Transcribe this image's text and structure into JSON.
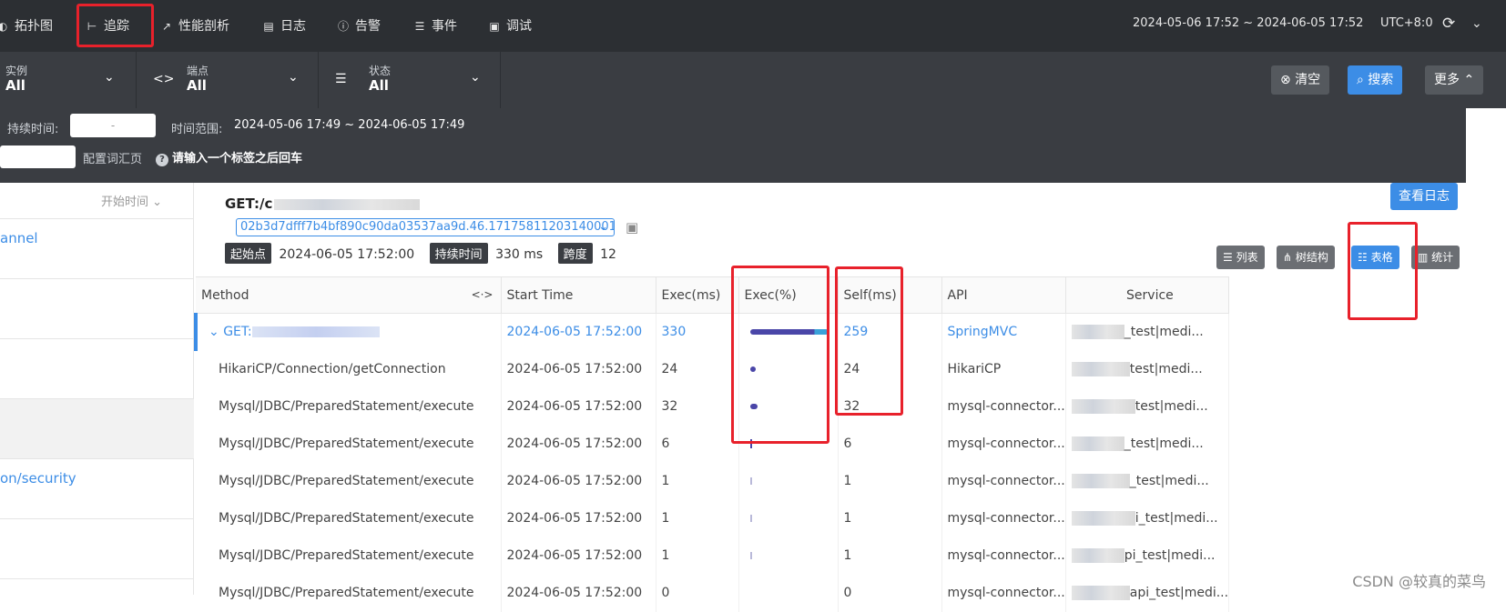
{
  "nav": {
    "items": [
      {
        "label": "拓扑图",
        "icon": "topology-icon"
      },
      {
        "label": "追踪",
        "icon": "trace-icon"
      },
      {
        "label": "性能剖析",
        "icon": "profiling-icon"
      },
      {
        "label": "日志",
        "icon": "log-icon"
      },
      {
        "label": "告警",
        "icon": "alarm-icon"
      },
      {
        "label": "事件",
        "icon": "event-icon"
      },
      {
        "label": "调试",
        "icon": "debug-icon"
      }
    ],
    "time_range": "2024-05-06 17:52 ~ 2024-06-05 17:52",
    "timezone": "UTC+8:0"
  },
  "filters": {
    "instance": {
      "label": "实例",
      "value": "All"
    },
    "endpoint": {
      "label": "端点",
      "value": "All"
    },
    "status": {
      "label": "状态",
      "value": "All"
    },
    "clear_label": "清空",
    "search_label": "搜索",
    "more_label": "更多"
  },
  "advanced": {
    "duration_label": "持续时间:",
    "duration_placeholder": "-",
    "time_range_label": "时间范围:",
    "time_range_value": "2024-05-06 17:49 ~ 2024-06-05 17:49",
    "config_label": "配置词汇页",
    "tag_hint": "请输入一个标签之后回车"
  },
  "trace_list": {
    "sort_label": "开始时间",
    "items": [
      "annel",
      "",
      "",
      "",
      "on/security",
      ""
    ]
  },
  "detail": {
    "title": "GET:/c",
    "trace_id": "02b3d7dfff7b4bf890c90da03537aa9d.46.17175811203140001",
    "start_label": "起始点",
    "start_value": "2024-06-05 17:52:00",
    "duration_label": "持续时间",
    "duration_value": "330 ms",
    "span_label": "跨度",
    "span_value": "12",
    "view_logs_label": "查看日志",
    "views": [
      "列表",
      "树结构",
      "表格",
      "统计"
    ]
  },
  "table": {
    "headers": [
      "Method",
      "Start Time",
      "Exec(ms)",
      "Exec(%)",
      "Self(ms)",
      "API",
      "Service"
    ],
    "rows": [
      {
        "method": "GET:",
        "start": "2024-06-05 17:52:00",
        "exec": "330",
        "exec_pct": 100,
        "self": "259",
        "api": "SpringMVC",
        "service": "_test|medi..."
      },
      {
        "method": "HikariCP/Connection/getConnection",
        "start": "2024-06-05 17:52:00",
        "exec": "24",
        "exec_pct": 7,
        "self": "24",
        "api": "HikariCP",
        "service": "test|medi..."
      },
      {
        "method": "Mysql/JDBC/PreparedStatement/execute",
        "start": "2024-06-05 17:52:00",
        "exec": "32",
        "exec_pct": 10,
        "self": "32",
        "api": "mysql-connector...",
        "service": "test|medi..."
      },
      {
        "method": "Mysql/JDBC/PreparedStatement/execute",
        "start": "2024-06-05 17:52:00",
        "exec": "6",
        "exec_pct": 2,
        "self": "6",
        "api": "mysql-connector...",
        "service": "_test|medi..."
      },
      {
        "method": "Mysql/JDBC/PreparedStatement/execute",
        "start": "2024-06-05 17:52:00",
        "exec": "1",
        "exec_pct": 0.3,
        "self": "1",
        "api": "mysql-connector...",
        "service": "_test|medi..."
      },
      {
        "method": "Mysql/JDBC/PreparedStatement/execute",
        "start": "2024-06-05 17:52:00",
        "exec": "1",
        "exec_pct": 0.3,
        "self": "1",
        "api": "mysql-connector...",
        "service": "i_test|medi..."
      },
      {
        "method": "Mysql/JDBC/PreparedStatement/execute",
        "start": "2024-06-05 17:52:00",
        "exec": "1",
        "exec_pct": 0.3,
        "self": "1",
        "api": "mysql-connector...",
        "service": "pi_test|medi..."
      },
      {
        "method": "Mysql/JDBC/PreparedStatement/execute",
        "start": "2024-06-05 17:52:00",
        "exec": "0",
        "exec_pct": 0,
        "self": "0",
        "api": "mysql-connector...",
        "service": "api_test|medi..."
      }
    ]
  },
  "watermark": "CSDN @较真的菜鸟",
  "colors": {
    "accent": "#3c8de6",
    "bar": "#4a46a8",
    "highlight": "#e8212b",
    "header_bg": "#2c2f33"
  }
}
